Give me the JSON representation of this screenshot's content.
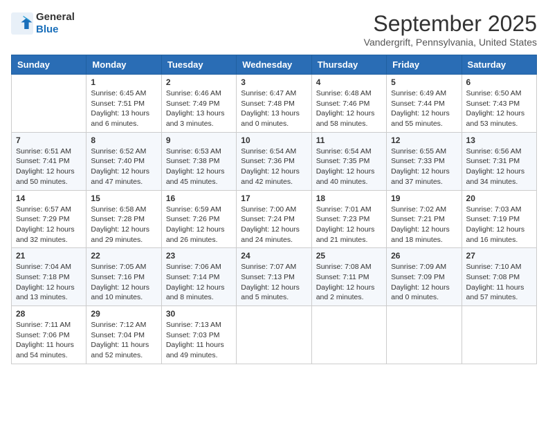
{
  "header": {
    "logo_line1": "General",
    "logo_line2": "Blue",
    "month_year": "September 2025",
    "location": "Vandergrift, Pennsylvania, United States"
  },
  "days_of_week": [
    "Sunday",
    "Monday",
    "Tuesday",
    "Wednesday",
    "Thursday",
    "Friday",
    "Saturday"
  ],
  "weeks": [
    [
      {
        "day": "",
        "sunrise": "",
        "sunset": "",
        "daylight": ""
      },
      {
        "day": "1",
        "sunrise": "Sunrise: 6:45 AM",
        "sunset": "Sunset: 7:51 PM",
        "daylight": "Daylight: 13 hours\nand 6 minutes."
      },
      {
        "day": "2",
        "sunrise": "Sunrise: 6:46 AM",
        "sunset": "Sunset: 7:49 PM",
        "daylight": "Daylight: 13 hours\nand 3 minutes."
      },
      {
        "day": "3",
        "sunrise": "Sunrise: 6:47 AM",
        "sunset": "Sunset: 7:48 PM",
        "daylight": "Daylight: 13 hours\nand 0 minutes."
      },
      {
        "day": "4",
        "sunrise": "Sunrise: 6:48 AM",
        "sunset": "Sunset: 7:46 PM",
        "daylight": "Daylight: 12 hours\nand 58 minutes."
      },
      {
        "day": "5",
        "sunrise": "Sunrise: 6:49 AM",
        "sunset": "Sunset: 7:44 PM",
        "daylight": "Daylight: 12 hours\nand 55 minutes."
      },
      {
        "day": "6",
        "sunrise": "Sunrise: 6:50 AM",
        "sunset": "Sunset: 7:43 PM",
        "daylight": "Daylight: 12 hours\nand 53 minutes."
      }
    ],
    [
      {
        "day": "7",
        "sunrise": "Sunrise: 6:51 AM",
        "sunset": "Sunset: 7:41 PM",
        "daylight": "Daylight: 12 hours\nand 50 minutes."
      },
      {
        "day": "8",
        "sunrise": "Sunrise: 6:52 AM",
        "sunset": "Sunset: 7:40 PM",
        "daylight": "Daylight: 12 hours\nand 47 minutes."
      },
      {
        "day": "9",
        "sunrise": "Sunrise: 6:53 AM",
        "sunset": "Sunset: 7:38 PM",
        "daylight": "Daylight: 12 hours\nand 45 minutes."
      },
      {
        "day": "10",
        "sunrise": "Sunrise: 6:54 AM",
        "sunset": "Sunset: 7:36 PM",
        "daylight": "Daylight: 12 hours\nand 42 minutes."
      },
      {
        "day": "11",
        "sunrise": "Sunrise: 6:54 AM",
        "sunset": "Sunset: 7:35 PM",
        "daylight": "Daylight: 12 hours\nand 40 minutes."
      },
      {
        "day": "12",
        "sunrise": "Sunrise: 6:55 AM",
        "sunset": "Sunset: 7:33 PM",
        "daylight": "Daylight: 12 hours\nand 37 minutes."
      },
      {
        "day": "13",
        "sunrise": "Sunrise: 6:56 AM",
        "sunset": "Sunset: 7:31 PM",
        "daylight": "Daylight: 12 hours\nand 34 minutes."
      }
    ],
    [
      {
        "day": "14",
        "sunrise": "Sunrise: 6:57 AM",
        "sunset": "Sunset: 7:29 PM",
        "daylight": "Daylight: 12 hours\nand 32 minutes."
      },
      {
        "day": "15",
        "sunrise": "Sunrise: 6:58 AM",
        "sunset": "Sunset: 7:28 PM",
        "daylight": "Daylight: 12 hours\nand 29 minutes."
      },
      {
        "day": "16",
        "sunrise": "Sunrise: 6:59 AM",
        "sunset": "Sunset: 7:26 PM",
        "daylight": "Daylight: 12 hours\nand 26 minutes."
      },
      {
        "day": "17",
        "sunrise": "Sunrise: 7:00 AM",
        "sunset": "Sunset: 7:24 PM",
        "daylight": "Daylight: 12 hours\nand 24 minutes."
      },
      {
        "day": "18",
        "sunrise": "Sunrise: 7:01 AM",
        "sunset": "Sunset: 7:23 PM",
        "daylight": "Daylight: 12 hours\nand 21 minutes."
      },
      {
        "day": "19",
        "sunrise": "Sunrise: 7:02 AM",
        "sunset": "Sunset: 7:21 PM",
        "daylight": "Daylight: 12 hours\nand 18 minutes."
      },
      {
        "day": "20",
        "sunrise": "Sunrise: 7:03 AM",
        "sunset": "Sunset: 7:19 PM",
        "daylight": "Daylight: 12 hours\nand 16 minutes."
      }
    ],
    [
      {
        "day": "21",
        "sunrise": "Sunrise: 7:04 AM",
        "sunset": "Sunset: 7:18 PM",
        "daylight": "Daylight: 12 hours\nand 13 minutes."
      },
      {
        "day": "22",
        "sunrise": "Sunrise: 7:05 AM",
        "sunset": "Sunset: 7:16 PM",
        "daylight": "Daylight: 12 hours\nand 10 minutes."
      },
      {
        "day": "23",
        "sunrise": "Sunrise: 7:06 AM",
        "sunset": "Sunset: 7:14 PM",
        "daylight": "Daylight: 12 hours\nand 8 minutes."
      },
      {
        "day": "24",
        "sunrise": "Sunrise: 7:07 AM",
        "sunset": "Sunset: 7:13 PM",
        "daylight": "Daylight: 12 hours\nand 5 minutes."
      },
      {
        "day": "25",
        "sunrise": "Sunrise: 7:08 AM",
        "sunset": "Sunset: 7:11 PM",
        "daylight": "Daylight: 12 hours\nand 2 minutes."
      },
      {
        "day": "26",
        "sunrise": "Sunrise: 7:09 AM",
        "sunset": "Sunset: 7:09 PM",
        "daylight": "Daylight: 12 hours\nand 0 minutes."
      },
      {
        "day": "27",
        "sunrise": "Sunrise: 7:10 AM",
        "sunset": "Sunset: 7:08 PM",
        "daylight": "Daylight: 11 hours\nand 57 minutes."
      }
    ],
    [
      {
        "day": "28",
        "sunrise": "Sunrise: 7:11 AM",
        "sunset": "Sunset: 7:06 PM",
        "daylight": "Daylight: 11 hours\nand 54 minutes."
      },
      {
        "day": "29",
        "sunrise": "Sunrise: 7:12 AM",
        "sunset": "Sunset: 7:04 PM",
        "daylight": "Daylight: 11 hours\nand 52 minutes."
      },
      {
        "day": "30",
        "sunrise": "Sunrise: 7:13 AM",
        "sunset": "Sunset: 7:03 PM",
        "daylight": "Daylight: 11 hours\nand 49 minutes."
      },
      {
        "day": "",
        "sunrise": "",
        "sunset": "",
        "daylight": ""
      },
      {
        "day": "",
        "sunrise": "",
        "sunset": "",
        "daylight": ""
      },
      {
        "day": "",
        "sunrise": "",
        "sunset": "",
        "daylight": ""
      },
      {
        "day": "",
        "sunrise": "",
        "sunset": "",
        "daylight": ""
      }
    ]
  ]
}
